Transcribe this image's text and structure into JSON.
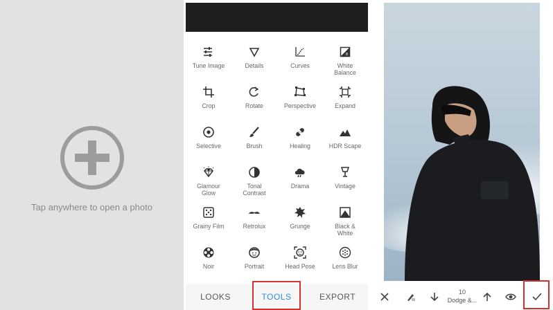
{
  "empty_state": {
    "prompt": "Tap anywhere to open a photo",
    "icon": "add-circle-icon"
  },
  "tools": [
    {
      "label": "Tune Image",
      "icon": "tune-icon"
    },
    {
      "label": "Details",
      "icon": "details-triangle-icon"
    },
    {
      "label": "Curves",
      "icon": "curves-icon"
    },
    {
      "label": "White\nBalance",
      "icon": "white-balance-icon"
    },
    {
      "label": "Crop",
      "icon": "crop-icon"
    },
    {
      "label": "Rotate",
      "icon": "rotate-icon"
    },
    {
      "label": "Perspective",
      "icon": "perspective-icon"
    },
    {
      "label": "Expand",
      "icon": "expand-icon"
    },
    {
      "label": "Selective",
      "icon": "selective-icon"
    },
    {
      "label": "Brush",
      "icon": "brush-icon"
    },
    {
      "label": "Healing",
      "icon": "healing-icon"
    },
    {
      "label": "HDR Scape",
      "icon": "hdr-scape-icon"
    },
    {
      "label": "Glamour\nGlow",
      "icon": "glamour-glow-icon"
    },
    {
      "label": "Tonal\nContrast",
      "icon": "tonal-contrast-icon"
    },
    {
      "label": "Drama",
      "icon": "drama-icon"
    },
    {
      "label": "Vintage",
      "icon": "vintage-icon"
    },
    {
      "label": "Grainy Film",
      "icon": "grainy-film-icon"
    },
    {
      "label": "Retrolux",
      "icon": "retrolux-icon"
    },
    {
      "label": "Grunge",
      "icon": "grunge-icon"
    },
    {
      "label": "Black &\nWhite",
      "icon": "black-white-icon"
    },
    {
      "label": "Noir",
      "icon": "noir-icon"
    },
    {
      "label": "Portrait",
      "icon": "portrait-icon"
    },
    {
      "label": "Head Pose",
      "icon": "head-pose-icon"
    },
    {
      "label": "Lens Blur",
      "icon": "lens-blur-icon"
    }
  ],
  "bottom_tabs": {
    "looks": "LOOKS",
    "tools": "TOOLS",
    "export": "EXPORT",
    "active": "tools"
  },
  "editor": {
    "brush_strength": "10",
    "brush_name": "Dodge &...",
    "toolbar_icons": [
      "close-icon",
      "brush-eraser-icon",
      "decrease-arrow-icon",
      "increase-arrow-icon",
      "eye-icon",
      "check-icon"
    ]
  },
  "colors": {
    "accent": "#2a8de0",
    "highlight": "#d63030",
    "empty_bg": "#e2e2e2"
  }
}
